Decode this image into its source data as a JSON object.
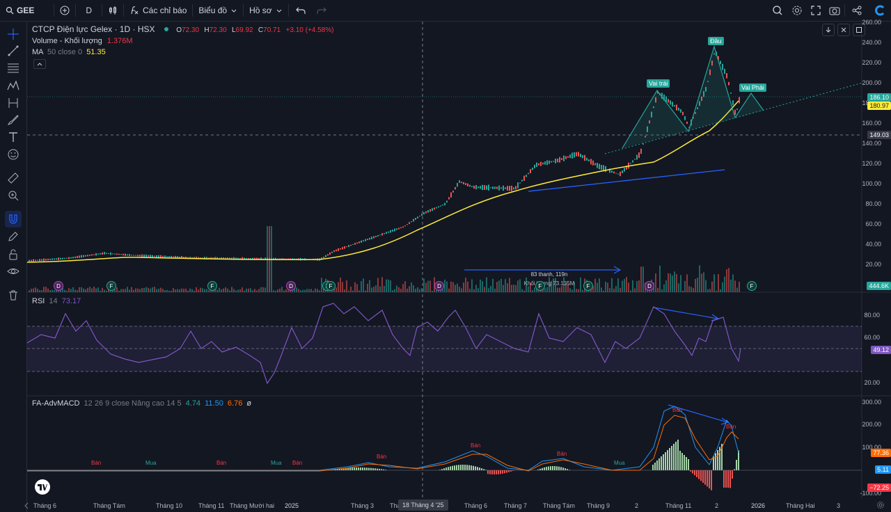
{
  "toolbar": {
    "symbol": "GEE",
    "interval": "D",
    "indicators": "Các chỉ báo",
    "chart_menu": "Biểu đồ",
    "profile": "Hồ sơ"
  },
  "legend": {
    "title": "CTCP Điện lực Gelex · 1D · HSX",
    "o_label": "O",
    "o_val": "72.30",
    "h_label": "H",
    "h_val": "72.30",
    "l_label": "L",
    "l_val": "69.92",
    "c_label": "C",
    "c_val": "70.71",
    "change": "+3.10 (+4.58%)",
    "volume_label": "Volume - Khối lượng",
    "volume_val": "1.376M",
    "ma_label": "MA",
    "ma_params": "50 close 0",
    "ma_val": "51.35"
  },
  "price_axis": {
    "ticks": [
      "260.00",
      "240.00",
      "220.00",
      "200.00",
      "180.00",
      "160.00",
      "140.00",
      "120.00",
      "100.00",
      "80.00",
      "60.00",
      "40.00",
      "20.00"
    ],
    "tag_last": "186.10",
    "tag_ma": "180.97",
    "tag_cross": "149.03",
    "tag_vol": "444.6K"
  },
  "annotations": {
    "head": "Đầu",
    "left_shoulder": "Vai trái",
    "right_shoulder": "Vai Phải",
    "range_info": "83 thanh, 119n",
    "range_vol": "Khối lượng 73.135M"
  },
  "event_markers": [
    "D",
    "F",
    "F",
    "D",
    "F",
    "F",
    "D",
    "F",
    "F",
    "D",
    "F"
  ],
  "rsi": {
    "label": "RSI",
    "params": "14",
    "val": "73.17",
    "ticks": [
      "80.00",
      "60.00",
      "40.00",
      "20.00"
    ],
    "tag": "49.12"
  },
  "macd": {
    "label": "FA-AdvMACD",
    "params": "12 26 9 close Nâng cao 14 5",
    "v1": "4.74",
    "v2": "11.50",
    "v3": "6.76",
    "v4": "ø",
    "ticks": [
      "300.00",
      "200.00",
      "100.00"
    ],
    "tick_neg": "-100.00",
    "tag1": "77.36",
    "tag2": "5.11",
    "tag3": "−72.25",
    "sell": "Bán",
    "buy": "Mua"
  },
  "time_axis": [
    "Tháng 6",
    "Tháng Tám",
    "Tháng 10",
    "Tháng 11",
    "Tháng Mười hai",
    "2025",
    "Tháng 3",
    "Thá",
    "Tháng 6",
    "Tháng 7",
    "Tháng Tám",
    "Tháng 9",
    "2",
    "Tháng 11",
    "2",
    "2026",
    "Tháng Hai",
    "3"
  ],
  "crosshair_date": "18 Tháng 4 '25",
  "chart_data": {
    "type": "line",
    "series": [
      {
        "name": "MA",
        "values": []
      }
    ],
    "yaxis_ticks": [
      20,
      40,
      60,
      80,
      100,
      120,
      140,
      160,
      180,
      200,
      220,
      240,
      260
    ]
  }
}
